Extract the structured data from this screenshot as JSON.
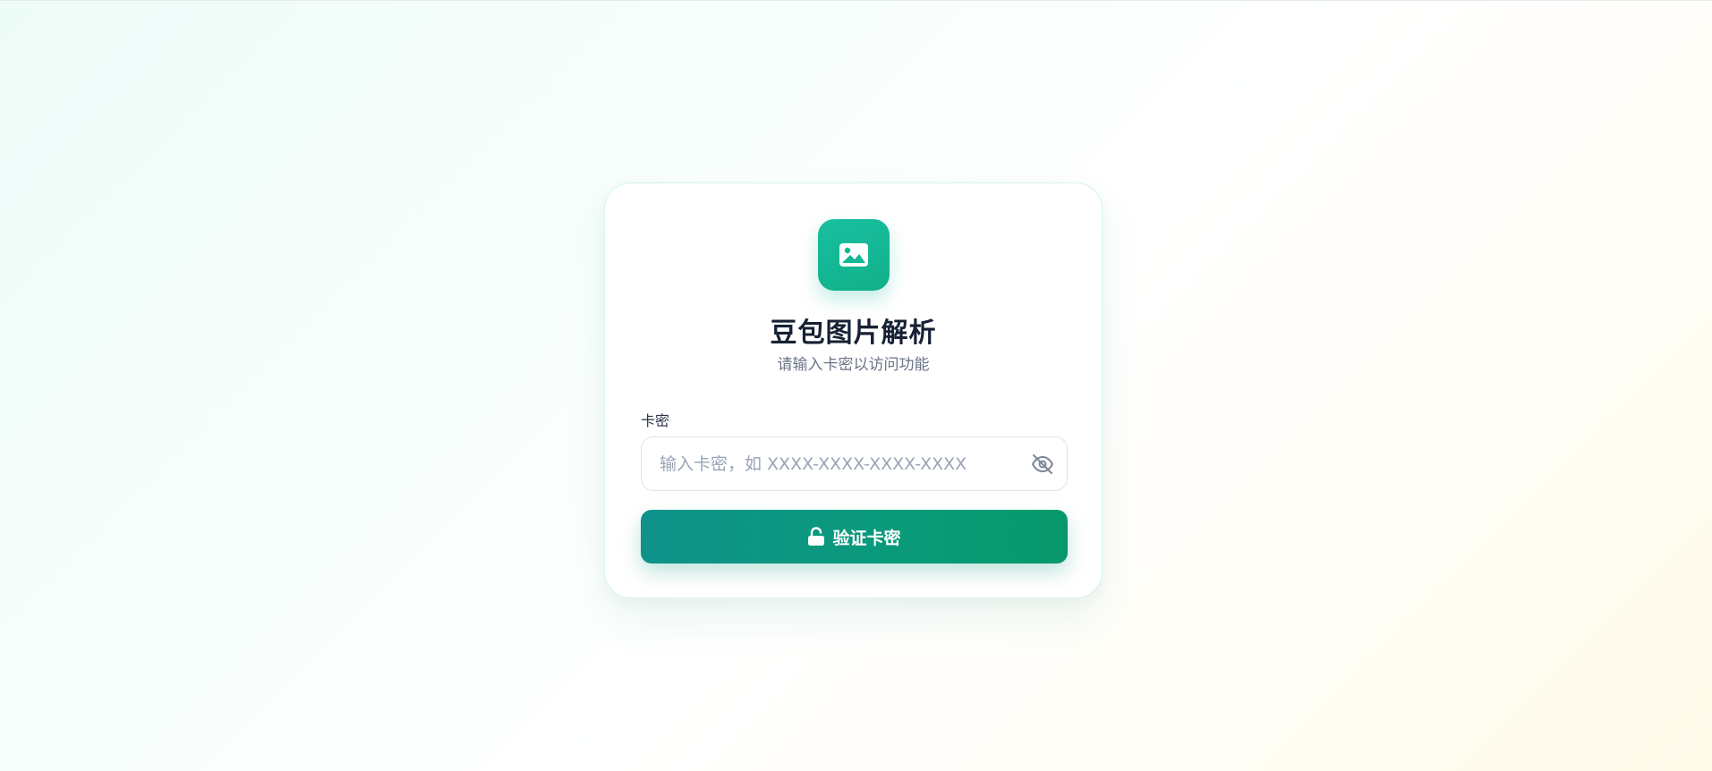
{
  "app": {
    "title": "豆包图片解析",
    "subtitle": "请输入卡密以访问功能"
  },
  "form": {
    "field_label": "卡密",
    "input_value": "",
    "input_placeholder": "输入卡密，如 XXXX-XXXX-XXXX-XXXX",
    "submit_label": "验证卡密"
  },
  "icons": {
    "logo": "image-icon",
    "toggle_visibility": "eye-off-icon",
    "submit": "lock-open-icon"
  },
  "colors": {
    "accent": "#14b896",
    "button_start": "#0e928a",
    "button_end": "#07986a",
    "title": "#172135",
    "subtitle": "#6b7587"
  }
}
